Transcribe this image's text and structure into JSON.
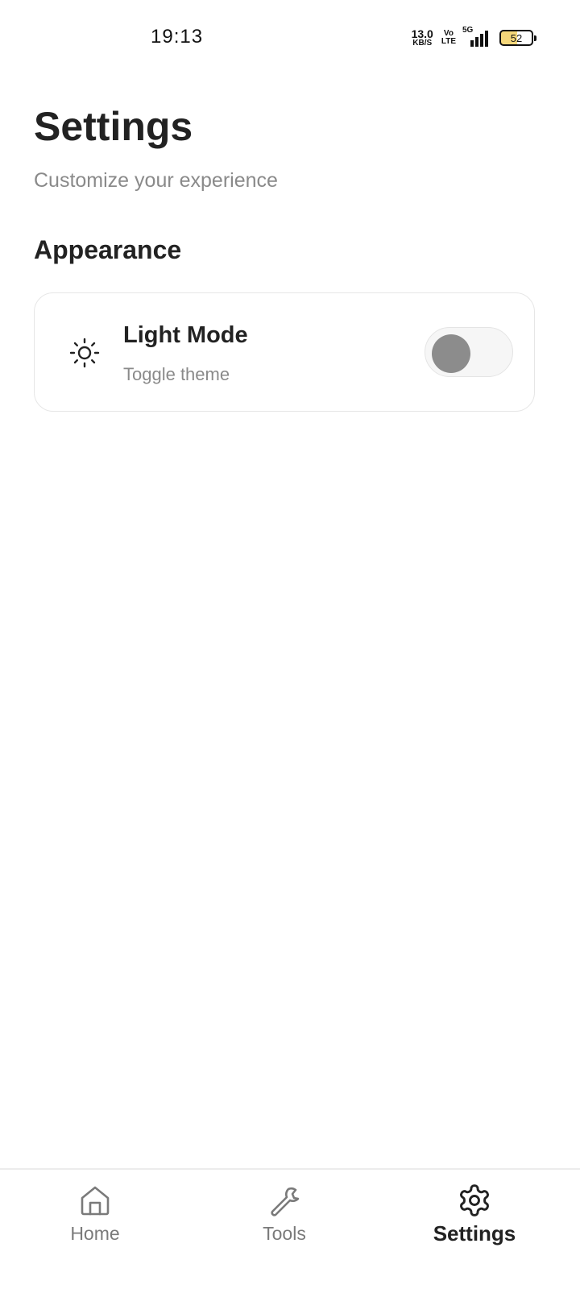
{
  "status_bar": {
    "time": "19:13",
    "net_speed_value": "13.0",
    "net_speed_unit": "KB/S",
    "volte_top": "Vo",
    "volte_bottom": "LTE",
    "network_type": "5G",
    "battery_level": "52"
  },
  "header": {
    "title": "Settings",
    "subtitle": "Customize your experience"
  },
  "sections": [
    {
      "title": "Appearance",
      "items": [
        {
          "icon": "sun-icon",
          "label": "Light Mode",
          "description": "Toggle theme",
          "toggle_on": false
        }
      ]
    }
  ],
  "bottom_nav": {
    "active": "Settings",
    "items": [
      {
        "icon": "home-icon",
        "label": "Home"
      },
      {
        "icon": "wrench-icon",
        "label": "Tools"
      },
      {
        "icon": "gear-icon",
        "label": "Settings"
      }
    ]
  },
  "colors": {
    "text_primary": "#222222",
    "text_secondary": "#8a8a8a",
    "card_border": "#e6e6e6",
    "toggle_knob_off": "#8c8c8c",
    "battery_fill": "#f5d77a"
  }
}
